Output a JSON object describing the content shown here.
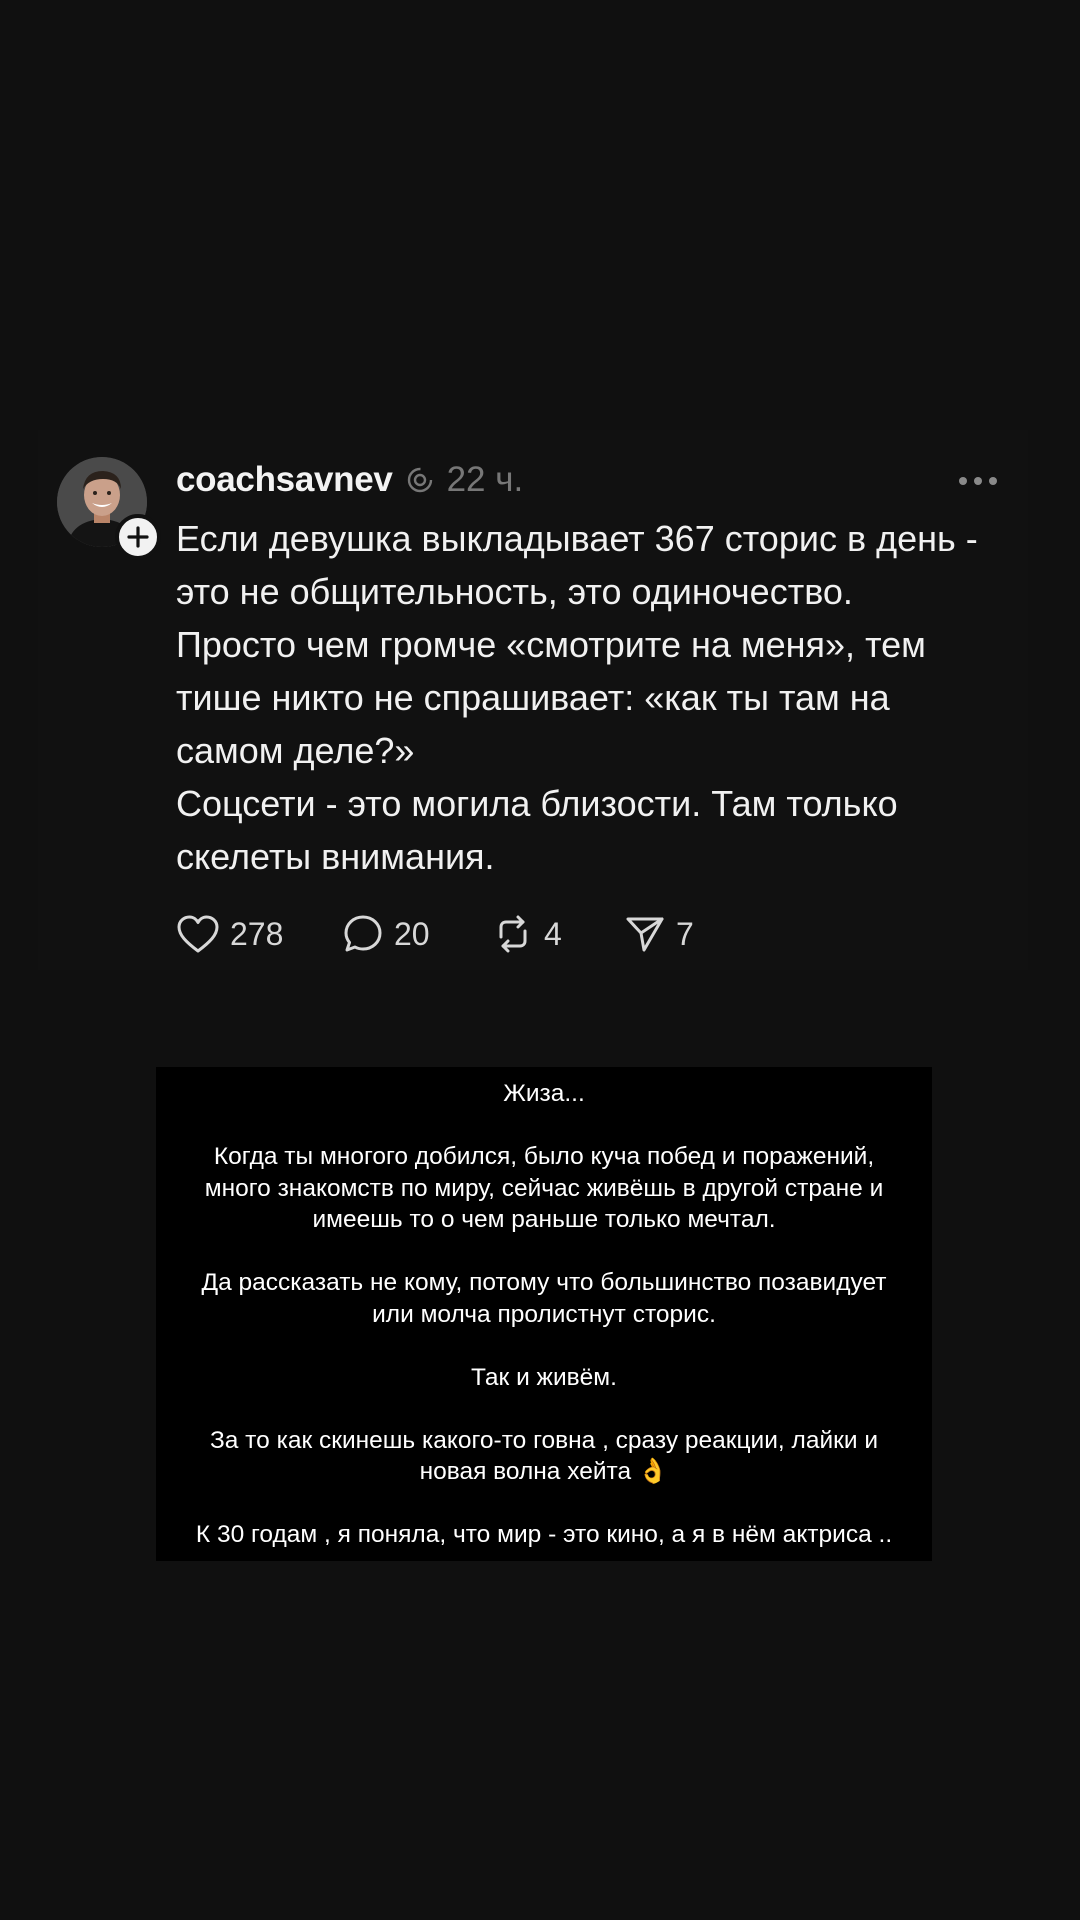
{
  "post": {
    "username": "coachsavnev",
    "timestamp": "22 ч.",
    "body_lines": [
      "Если девушка выкладывает 367 сторис в день -",
      "это не общительность, это одиночество.",
      "Просто чем громче «смотрите на меня», тем",
      "тише никто не спрашивает: «как ты там на",
      "самом деле?»",
      "Соцсети - это могила близости. Там только",
      "скелеты внимания."
    ],
    "likes": "278",
    "comments": "20",
    "reposts": "4",
    "shares": "7"
  },
  "story": {
    "title": "Жиза...",
    "para1": [
      "Когда ты многого добился, было куча побед и поражений,",
      "много знакомств по миру, сейчас живёшь в другой стране и",
      "имеешь то о чем раньше только мечтал."
    ],
    "para2": [
      "Да рассказать не кому, потому что большинство позавидует",
      "или молча пролистнут сторис."
    ],
    "para3": "Так и живём.",
    "para4": [
      "За то как скинешь какого-то говна , сразу реакции, лайки и",
      "новая волна хейта 👌"
    ],
    "para5": "К 30 годам , я поняла, что мир - это кино, а я в нём актриса .."
  },
  "colors": {
    "background": "#101010",
    "text": "#f1f1f1",
    "muted": "#777777",
    "story_background": "#000000"
  },
  "icons": [
    "plus-icon",
    "reply-circle-icon",
    "more-dots-icon",
    "heart-icon",
    "comment-icon",
    "repost-icon",
    "send-icon",
    "ok-hand-emoji"
  ]
}
